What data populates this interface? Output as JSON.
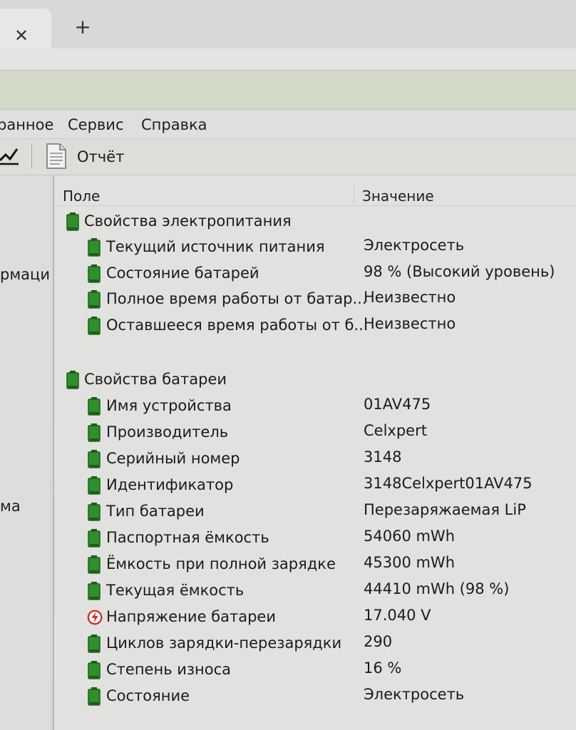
{
  "browser": {
    "close_glyph": "✕",
    "new_tab_glyph": "+"
  },
  "menu": {
    "items": [
      "ранное",
      "Сервис",
      "Справка"
    ]
  },
  "toolbar": {
    "report_label": "Отчёт"
  },
  "left_panel": {
    "labels": [
      "рмаци",
      "ма"
    ]
  },
  "table": {
    "columns": {
      "field": "Поле",
      "value": "Значение"
    },
    "groups": [
      {
        "title": "Свойства электропитания",
        "rows": [
          {
            "field": "Текущий источник питания",
            "value": "Электросеть",
            "icon": "battery-icon"
          },
          {
            "field": "Состояние батарей",
            "value": "98 % (Высокий уровень)",
            "icon": "battery-icon"
          },
          {
            "field": "Полное время работы от батар...",
            "value": "Неизвестно",
            "icon": "battery-icon"
          },
          {
            "field": "Оставшееся время работы от б...",
            "value": "Неизвестно",
            "icon": "battery-icon"
          }
        ]
      },
      {
        "title": "Свойства батареи",
        "rows": [
          {
            "field": "Имя устройства",
            "value": "01AV475",
            "icon": "battery-icon"
          },
          {
            "field": "Производитель",
            "value": "Celxpert",
            "icon": "battery-icon"
          },
          {
            "field": "Серийный номер",
            "value": "3148",
            "icon": "battery-icon"
          },
          {
            "field": "Идентификатор",
            "value": "3148Celxpert01AV475",
            "icon": "battery-icon"
          },
          {
            "field": "Тип батареи",
            "value": "Перезаряжаемая LiP",
            "icon": "battery-icon"
          },
          {
            "field": "Паспортная ёмкость",
            "value": "54060 mWh",
            "icon": "battery-icon"
          },
          {
            "field": "Ёмкость при полной зарядке",
            "value": "45300 mWh",
            "icon": "battery-icon"
          },
          {
            "field": "Текущая ёмкость",
            "value": "44410 mWh  (98 %)",
            "icon": "battery-icon"
          },
          {
            "field": "Напряжение батареи",
            "value": "17.040 V",
            "icon": "voltage-icon"
          },
          {
            "field": "Циклов зарядки-перезарядки",
            "value": "290",
            "icon": "battery-icon"
          },
          {
            "field": "Степень износа",
            "value": "16 %",
            "icon": "battery-icon"
          },
          {
            "field": "Состояние",
            "value": "Электросеть",
            "icon": "battery-icon"
          }
        ]
      }
    ]
  },
  "colors": {
    "battery_green": "#2f8f2a",
    "battery_dark": "#1d5c1a",
    "voltage_red": "#d12b1f"
  }
}
